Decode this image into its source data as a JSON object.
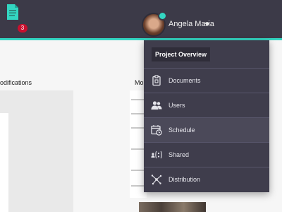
{
  "header": {
    "notification_count": "3",
    "user_name": "Angela Maria"
  },
  "content": {
    "left_section_title": "odifications",
    "right_section_title": "Mo"
  },
  "menu": {
    "title": "Project Overview",
    "items": [
      {
        "label": "Documents",
        "icon": "clipboard-icon"
      },
      {
        "label": "Users",
        "icon": "users-icon"
      },
      {
        "label": "Schedule",
        "icon": "calendar-clock-icon",
        "active": true
      },
      {
        "label": "Shared",
        "icon": "shared-icon"
      },
      {
        "label": "Distribution",
        "icon": "distribution-icon"
      }
    ]
  },
  "colors": {
    "topbar": "#3c3a48",
    "accent": "#33d6c2",
    "dropdown": "#3f3d4c",
    "badge": "#c8102e"
  }
}
